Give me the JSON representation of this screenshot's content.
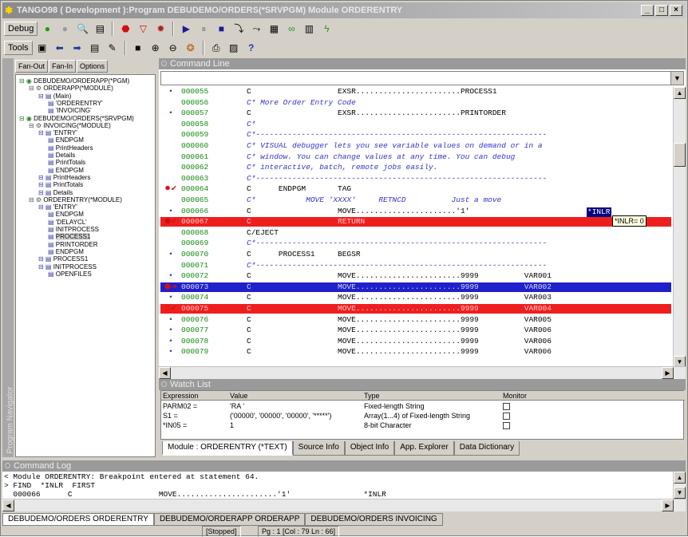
{
  "window": {
    "title": "TANGO98 ( Development ):Program DEBUDEMO/ORDERS(*SRVPGM) Module ORDERENTRY",
    "min": "_",
    "max": "□",
    "close": "×"
  },
  "toolbar1": {
    "label": "Debug"
  },
  "toolbar2": {
    "label": "Tools"
  },
  "navigator": {
    "vertical_label": "Program Navigator",
    "tabs": [
      "Fan-Out",
      "Fan-In",
      "Options"
    ],
    "tree": [
      {
        "depth": 0,
        "text": "DEBUDEMO/ORDERAPP(*PGM)"
      },
      {
        "depth": 1,
        "text": "ORDERAPP(*MODULE)"
      },
      {
        "depth": 2,
        "text": "(Main)"
      },
      {
        "depth": 3,
        "text": "'ORDERENTRY'"
      },
      {
        "depth": 3,
        "text": "'INVOICING'"
      },
      {
        "depth": 0,
        "text": "DEBUDEMO/ORDERS(*SRVPGM)"
      },
      {
        "depth": 1,
        "text": "INVOICING(*MODULE)"
      },
      {
        "depth": 2,
        "text": "'ENTRY'"
      },
      {
        "depth": 3,
        "text": "ENDPGM"
      },
      {
        "depth": 3,
        "text": "PrintHeaders"
      },
      {
        "depth": 3,
        "text": "Details"
      },
      {
        "depth": 3,
        "text": "PrintTotals"
      },
      {
        "depth": 3,
        "text": "ENDPGM"
      },
      {
        "depth": 2,
        "text": "PrintHeaders"
      },
      {
        "depth": 2,
        "text": "PrintTotals"
      },
      {
        "depth": 2,
        "text": "Details"
      },
      {
        "depth": 1,
        "text": "ORDERENTRY(*MODULE)"
      },
      {
        "depth": 2,
        "text": "'ENTRY'"
      },
      {
        "depth": 3,
        "text": "ENDPGM"
      },
      {
        "depth": 3,
        "text": "'DELAYCL'"
      },
      {
        "depth": 3,
        "text": "INITPROCESS"
      },
      {
        "depth": 3,
        "text": "PROCESS1"
      },
      {
        "depth": 3,
        "text": "PRINTORDER"
      },
      {
        "depth": 3,
        "text": "ENDPGM"
      },
      {
        "depth": 2,
        "text": "PROCESS1"
      },
      {
        "depth": 2,
        "text": "INITPROCESS"
      },
      {
        "depth": 3,
        "text": "OPENFILES"
      }
    ]
  },
  "command_line": {
    "title": "Command Line",
    "input_value": "",
    "rows": [
      {
        "mark": "•",
        "num": "000055",
        "text": "C                   EXSR.......................PROCESS1",
        "type": "normal"
      },
      {
        "mark": "",
        "num": "000056",
        "text": "C* More Order Entry Code",
        "type": "comment"
      },
      {
        "mark": "•",
        "num": "000057",
        "text": "C                   EXSR.......................PRINTORDER",
        "type": "normal"
      },
      {
        "mark": "",
        "num": "000058",
        "text": "C*",
        "type": "comment"
      },
      {
        "mark": "",
        "num": "000059",
        "text": "C*----------------------------------------------------------------",
        "type": "comment"
      },
      {
        "mark": "",
        "num": "000060",
        "text": "C* VISUAL debugger lets you see variable values on demand or in a",
        "type": "comment"
      },
      {
        "mark": "",
        "num": "000061",
        "text": "C* window. You can change values at any time. You can debug",
        "type": "comment"
      },
      {
        "mark": "",
        "num": "000062",
        "text": "C* interactive, batch, remote jobs easily.",
        "type": "comment"
      },
      {
        "mark": "",
        "num": "000063",
        "text": "C*----------------------------------------------------------------",
        "type": "comment"
      },
      {
        "mark": "bp-check",
        "num": "000064",
        "text": "C      ENDPGM       TAG",
        "type": "normal"
      },
      {
        "mark": "",
        "num": "000065",
        "text": "C*           MOVE 'XXXX'     RETNCD          Just a move",
        "type": "comment"
      },
      {
        "mark": "•",
        "num": "000066",
        "text": "C                   MOVE......................'1'",
        "type": "normal"
      },
      {
        "mark": "stop-check",
        "num": "000067",
        "text": "C                   RETURN",
        "type": "red"
      },
      {
        "mark": "",
        "num": "000068",
        "text": "C/EJECT",
        "type": "normal"
      },
      {
        "mark": "",
        "num": "000069",
        "text": "C*----------------------------------------------------------------",
        "type": "comment"
      },
      {
        "mark": "•",
        "num": "000070",
        "text": "C      PROCESS1     BEGSR",
        "type": "normal"
      },
      {
        "mark": "",
        "num": "000071",
        "text": "C*----------------------------------------------------------------",
        "type": "comment"
      },
      {
        "mark": "•",
        "num": "000072",
        "text": "C                   MOVE.......................9999          VAR001",
        "type": "normal"
      },
      {
        "mark": "stop-arrow",
        "num": "000073",
        "text": "C                   MOVE.......................9999          VAR002",
        "type": "blue"
      },
      {
        "mark": "•",
        "num": "000074",
        "text": "C                   MOVE.......................9999          VAR003",
        "type": "normal"
      },
      {
        "mark": "tri-check",
        "num": "000075",
        "text": "C                   MOVE.......................9999          VAR004",
        "type": "red"
      },
      {
        "mark": "•",
        "num": "000076",
        "text": "C                   MOVE.......................9999          VAR005",
        "type": "normal"
      },
      {
        "mark": "•",
        "num": "000077",
        "text": "C                   MOVE.......................9999          VAR006",
        "type": "normal"
      },
      {
        "mark": "•",
        "num": "000078",
        "text": "C                   MOVE.......................9999          VAR006",
        "type": "normal"
      },
      {
        "mark": "•",
        "num": "000079",
        "text": "C                   MOVE.......................9999          VAR006",
        "type": "normal"
      }
    ],
    "highlight_var": "*INLR",
    "tooltip": "*INLR= 0"
  },
  "watch_list": {
    "title": "Watch List",
    "headers": [
      "Expression",
      "Value",
      "Type",
      "Monitor"
    ],
    "rows": [
      {
        "expr": "PARM02 =",
        "value": "'RA      '",
        "type": "Fixed-length String"
      },
      {
        "expr": "S1 =",
        "value": "('00000', '00000', '00000', '*****')",
        "type": "Array(1...4) of Fixed-length String"
      },
      {
        "expr": "*IN05 =",
        "value": "1",
        "type": "8-bit Character"
      }
    ],
    "tabs": [
      "Module : ORDERENTRY (*TEXT)",
      "Source Info",
      "Object Info",
      "App. Explorer",
      "Data Dictionary"
    ]
  },
  "command_log": {
    "title": "Command Log",
    "lines": [
      "< Module ORDERENTRY: Breakpoint entered at statement 64.",
      "> FIND  *INLR  FIRST",
      "  000066      C                   MOVE......................'1'                *INLR"
    ]
  },
  "file_tabs": [
    "DEBUDEMO/ORDERS ORDERENTRY",
    "DEBUDEMO/ORDERAPP ORDERAPP",
    "DEBUDEMO/ORDERS INVOICING"
  ],
  "status": {
    "state": "[Stopped]",
    "pos": "Pg : 1 [Col : 79 Ln : 66]"
  }
}
